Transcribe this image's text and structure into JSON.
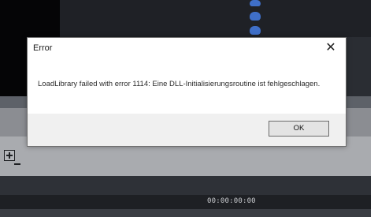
{
  "dialog": {
    "title": "Error",
    "close_label": "✕",
    "message": "LoadLibrary failed with error 1114: Eine DLL-Initialisierungsroutine ist fehlgeschlagen.",
    "ok_label": "OK"
  },
  "timeline": {
    "timecode": "00:00:00:00"
  }
}
